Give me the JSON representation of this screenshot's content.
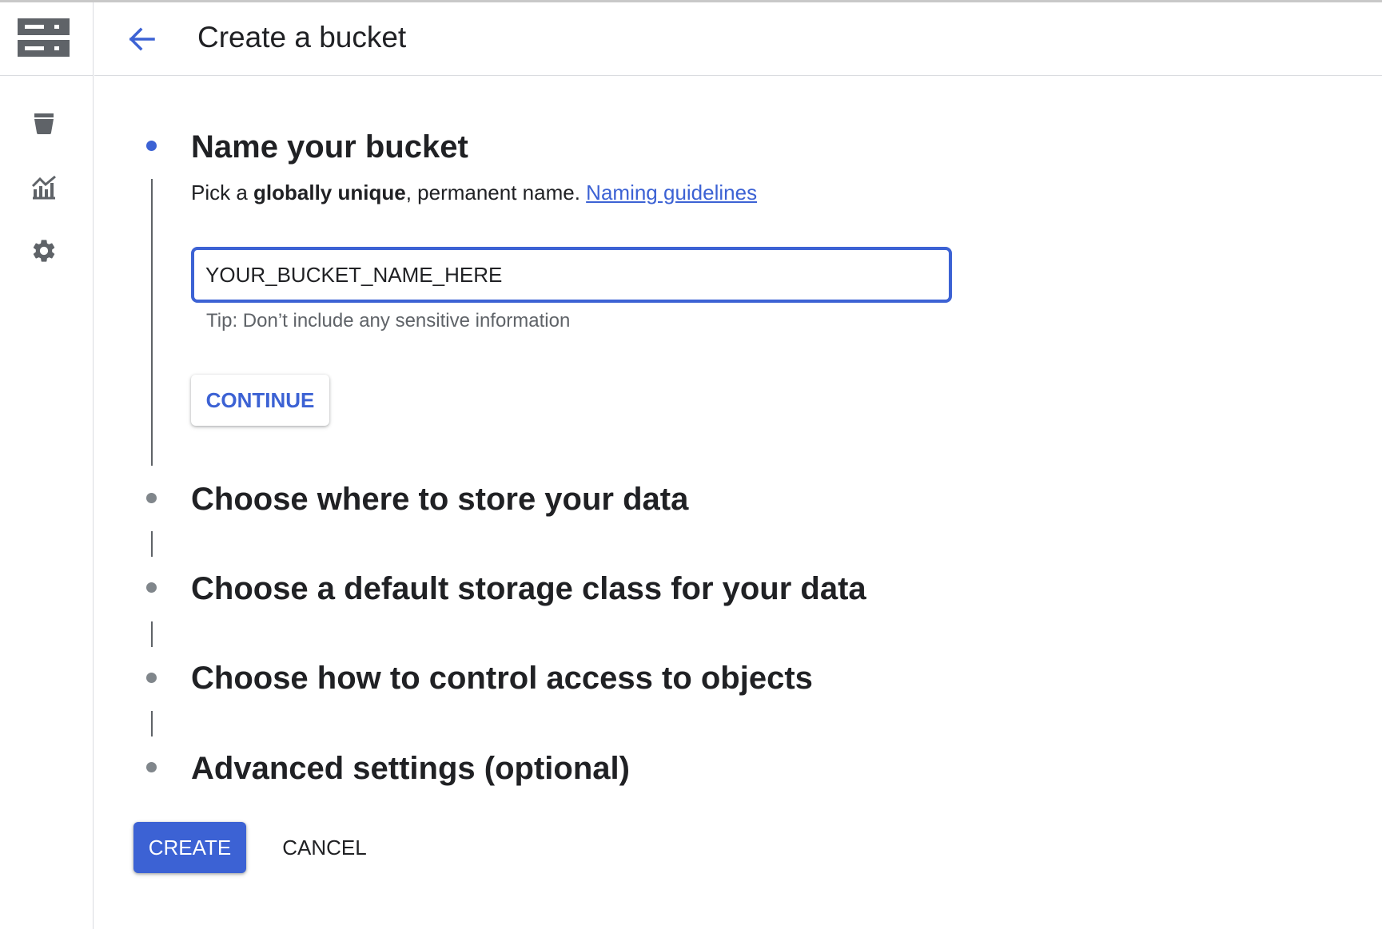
{
  "header": {
    "title": "Create a bucket",
    "back_icon": "arrow-back-icon"
  },
  "rail": {
    "logo_icon": "storage-icon",
    "items": [
      {
        "icon": "bucket-icon"
      },
      {
        "icon": "analytics-icon"
      },
      {
        "icon": "gear-icon"
      }
    ]
  },
  "steps": {
    "step1": {
      "title": "Name your bucket",
      "desc_prefix": "Pick a ",
      "desc_bold": "globally unique",
      "desc_suffix": ", permanent name. ",
      "link": "Naming guidelines",
      "input_value": "YOUR_BUCKET_NAME_HERE",
      "tip": "Tip: Don’t include any sensitive information",
      "continue_label": "CONTINUE"
    },
    "step2": {
      "title": "Choose where to store your data"
    },
    "step3": {
      "title": "Choose a default storage class for your data"
    },
    "step4": {
      "title": "Choose how to control access to objects"
    },
    "step5": {
      "title": "Advanced settings (optional)"
    }
  },
  "actions": {
    "create_label": "CREATE",
    "cancel_label": "CANCEL"
  },
  "colors": {
    "accent": "#3c62d4",
    "icon_gray": "#5f6368",
    "text": "#202124"
  }
}
